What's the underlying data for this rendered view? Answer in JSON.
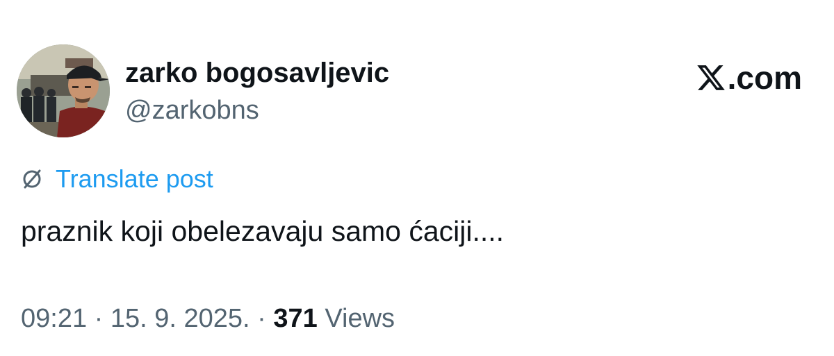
{
  "author": {
    "display_name": "zarko bogosavljevic",
    "handle": "@zarkobns",
    "avatar_icon": "avatar-portrait"
  },
  "brand": {
    "icon": "x-logo-icon",
    "text": ".com"
  },
  "translate": {
    "icon": "globe-icon",
    "label": "Translate post",
    "color": "#1d9bf0"
  },
  "post": {
    "text": "praznik koji obelezavaju samo ćaciji...."
  },
  "meta": {
    "time": "09:21",
    "separator": " · ",
    "date": "15. 9. 2025.",
    "separator2": " · ",
    "views_count": "371",
    "views_label": " Views"
  },
  "colors": {
    "text_primary": "#0f1419",
    "text_secondary": "#536471",
    "link": "#1d9bf0"
  }
}
